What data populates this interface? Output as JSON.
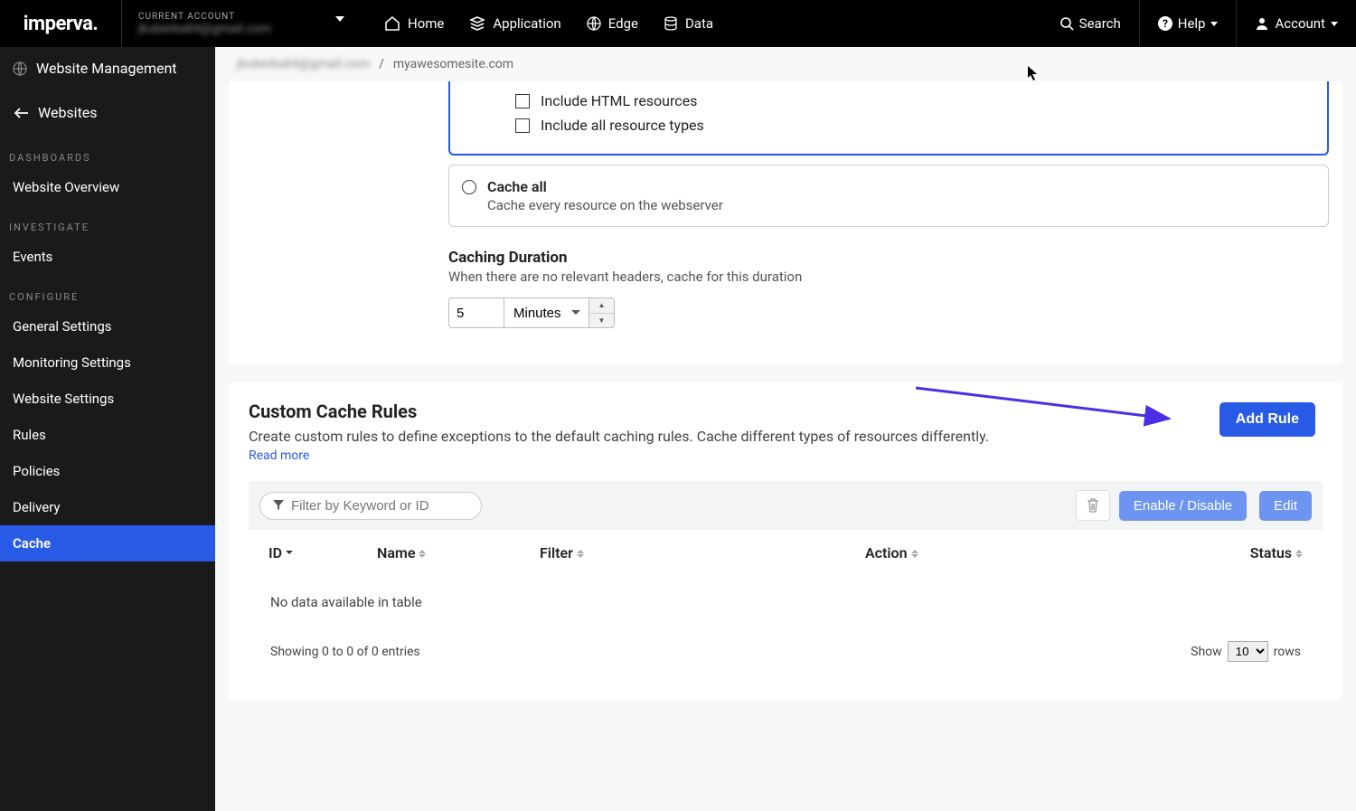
{
  "brand": "imperva",
  "account_selector": {
    "label": "CURRENT ACCOUNT",
    "value": "jkuberka84@gmail.com"
  },
  "nav": {
    "home": "Home",
    "application": "Application",
    "edge": "Edge",
    "data": "Data",
    "search": "Search",
    "help": "Help",
    "account": "Account"
  },
  "sidebar": {
    "title": "Website Management",
    "back": "Websites",
    "sections": {
      "dashboards": "DASHBOARDS",
      "investigate": "INVESTIGATE",
      "configure": "CONFIGURE"
    },
    "items": {
      "overview": "Website Overview",
      "events": "Events",
      "general": "General Settings",
      "monitoring": "Monitoring Settings",
      "website": "Website Settings",
      "rules": "Rules",
      "policies": "Policies",
      "delivery": "Delivery",
      "cache": "Cache"
    }
  },
  "breadcrumb": {
    "acct": "jkuberka84@gmail.com",
    "sep": "/",
    "site": "myawesomesite.com"
  },
  "cache_opts": {
    "include_html": "Include HTML resources",
    "include_all": "Include all resource types",
    "cache_all_title": "Cache all",
    "cache_all_desc": "Cache every resource on the webserver"
  },
  "duration": {
    "heading": "Caching Duration",
    "desc": "When there are no relevant headers, cache for this duration",
    "value": "5",
    "unit": "Minutes"
  },
  "custom": {
    "heading": "Custom Cache Rules",
    "desc": "Create custom rules to define exceptions to the default caching rules. Cache different types of resources differently.",
    "read_more": "Read more",
    "add_rule": "Add Rule",
    "filter_placeholder": "Filter by Keyword or ID",
    "enable_disable": "Enable / Disable",
    "edit": "Edit",
    "cols": {
      "id": "ID",
      "name": "Name",
      "filter": "Filter",
      "action": "Action",
      "status": "Status"
    },
    "empty": "No data available in table",
    "showing": "Showing 0 to 0 of 0 entries",
    "show_label": "Show",
    "rows_label": "rows",
    "rows_value": "10"
  }
}
